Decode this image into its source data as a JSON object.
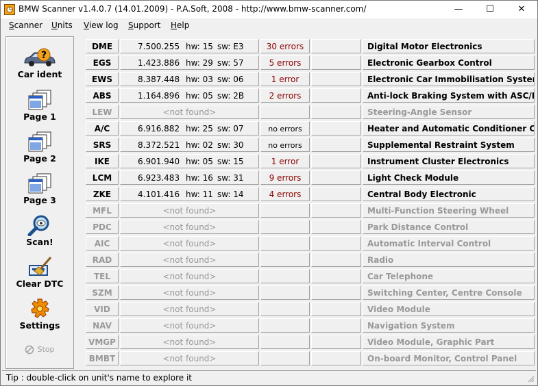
{
  "window": {
    "title": "BMW Scanner v1.4.0.7 (14.01.2009) - P.A.Soft, 2008 - http://www.bmw-scanner.com/",
    "min_glyph": "—",
    "max_glyph": "☐",
    "close_glyph": "✕"
  },
  "menu": [
    {
      "first": "S",
      "rest": "canner"
    },
    {
      "first": "U",
      "rest": "nits"
    },
    {
      "first": "V",
      "rest": "iew log"
    },
    {
      "first": "S",
      "rest": "upport"
    },
    {
      "first": "H",
      "rest": "elp"
    }
  ],
  "sidebar": {
    "car_ident": "Car ident",
    "page1": "Page 1",
    "page2": "Page 2",
    "page3": "Page 3",
    "scan": "Scan!",
    "clear_dtc": "Clear DTC",
    "settings": "Settings",
    "stop": "Stop"
  },
  "units": [
    {
      "code": "DME",
      "part": "7.500.255",
      "hw": "hw: 15",
      "sw": "sw: E3",
      "errors": "30 errors",
      "name": "Digital Motor Electronics"
    },
    {
      "code": "EGS",
      "part": "1.423.886",
      "hw": "hw: 29",
      "sw": "sw: 57",
      "errors": "5 errors",
      "name": "Electronic Gearbox Control"
    },
    {
      "code": "EWS",
      "part": "8.387.448",
      "hw": "hw: 03",
      "sw": "sw: 06",
      "errors": "1 error",
      "name": "Electronic Car Immobilisation System"
    },
    {
      "code": "ABS",
      "part": "1.164.896",
      "hw": "hw: 05",
      "sw": "sw: 2B",
      "errors": "2 errors",
      "name": "Anti-lock Braking System with ASC/DSC"
    },
    {
      "code": "LEW",
      "not_found": "<not found>",
      "name": "Steering-Angle Sensor"
    },
    {
      "code": "A/C",
      "part": "6.916.882",
      "hw": "hw: 25",
      "sw": "sw: 07",
      "errors": "no errors",
      "name": "Heater and Automatic Conditioner Control"
    },
    {
      "code": "SRS",
      "part": "8.372.521",
      "hw": "hw: 02",
      "sw": "sw: 30",
      "errors": "no errors",
      "name": "Supplemental Restraint System"
    },
    {
      "code": "IKE",
      "part": "6.901.940",
      "hw": "hw: 05",
      "sw": "sw: 15",
      "errors": "1 error",
      "name": "Instrument Cluster Electronics"
    },
    {
      "code": "LCM",
      "part": "6.923.483",
      "hw": "hw: 16",
      "sw": "sw: 31",
      "errors": "9 errors",
      "name": "Light Check Module"
    },
    {
      "code": "ZKE",
      "part": "4.101.416",
      "hw": "hw: 11",
      "sw": "sw: 14",
      "errors": "4 errors",
      "name": "Central Body Electronic"
    },
    {
      "code": "MFL",
      "not_found": "<not found>",
      "name": "Multi-Function Steering Wheel"
    },
    {
      "code": "PDC",
      "not_found": "<not found>",
      "name": "Park Distance Control"
    },
    {
      "code": "AIC",
      "not_found": "<not found>",
      "name": "Automatic Interval Control"
    },
    {
      "code": "RAD",
      "not_found": "<not found>",
      "name": "Radio"
    },
    {
      "code": "TEL",
      "not_found": "<not found>",
      "name": "Car Telephone"
    },
    {
      "code": "SZM",
      "not_found": "<not found>",
      "name": "Switching Center, Centre Console"
    },
    {
      "code": "VID",
      "not_found": "<not found>",
      "name": "Video Module"
    },
    {
      "code": "NAV",
      "not_found": "<not found>",
      "name": "Navigation System"
    },
    {
      "code": "VMGP",
      "not_found": "<not found>",
      "name": "Video Module, Graphic Part"
    },
    {
      "code": "BMBT",
      "not_found": "<not found>",
      "name": "On-board Monitor, Control Panel"
    }
  ],
  "status": {
    "tip": "Tip : double-click on unit's name to explore it"
  },
  "colors": {
    "error_text": "#8b0000",
    "disabled_text": "#999999",
    "face": "#f0f0f0"
  }
}
